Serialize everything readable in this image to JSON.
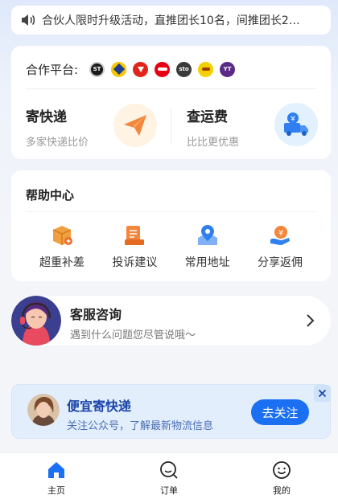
{
  "notice": {
    "text": "合伙人限时升级活动，直推团长10名，间推团长2…",
    "icon": "speaker-icon"
  },
  "partners": {
    "label": "合作平台:",
    "logos": [
      {
        "name": "sf-express-logo",
        "text": "ST",
        "color": "#1a1a1a"
      },
      {
        "name": "yunda-logo",
        "text": "",
        "color": "#1e3d8f"
      },
      {
        "name": "jd-logo",
        "text": "",
        "color": "#e2231a"
      },
      {
        "name": "debang-logo",
        "text": "",
        "color": "#e60012"
      },
      {
        "name": "sto-logo",
        "text": "sto",
        "color": "#3a3a3a"
      },
      {
        "name": "best-logo",
        "text": "",
        "color": "#f5c800"
      },
      {
        "name": "yt-logo",
        "text": "YT",
        "color": "#5b2a86"
      }
    ]
  },
  "services": {
    "send": {
      "title": "寄快递",
      "sub": "多家快递比价"
    },
    "price": {
      "title": "查运费",
      "sub": "比比更优惠"
    }
  },
  "help": {
    "title": "帮助中心",
    "items": [
      {
        "label": "超重补差",
        "icon": "box-plus-icon"
      },
      {
        "label": "投诉建议",
        "icon": "feedback-icon"
      },
      {
        "label": "常用地址",
        "icon": "location-pin-icon"
      },
      {
        "label": "分享返佣",
        "icon": "share-yuan-icon"
      }
    ]
  },
  "customer_service": {
    "title": "客服咨询",
    "sub": "遇到什么问题您尽管说哦～"
  },
  "follow": {
    "title": "便宜寄快递",
    "sub": "关注公众号，了解最新物流信息",
    "button": "去关注"
  },
  "tabs": [
    {
      "label": "主页",
      "icon": "home-icon",
      "active": true
    },
    {
      "label": "订单",
      "icon": "order-search-icon",
      "active": false
    },
    {
      "label": "我的",
      "icon": "profile-smile-icon",
      "active": false
    }
  ],
  "colors": {
    "accent": "#1b6ff2",
    "orange": "#f3863a",
    "page_bg": "#f3f5f9"
  }
}
